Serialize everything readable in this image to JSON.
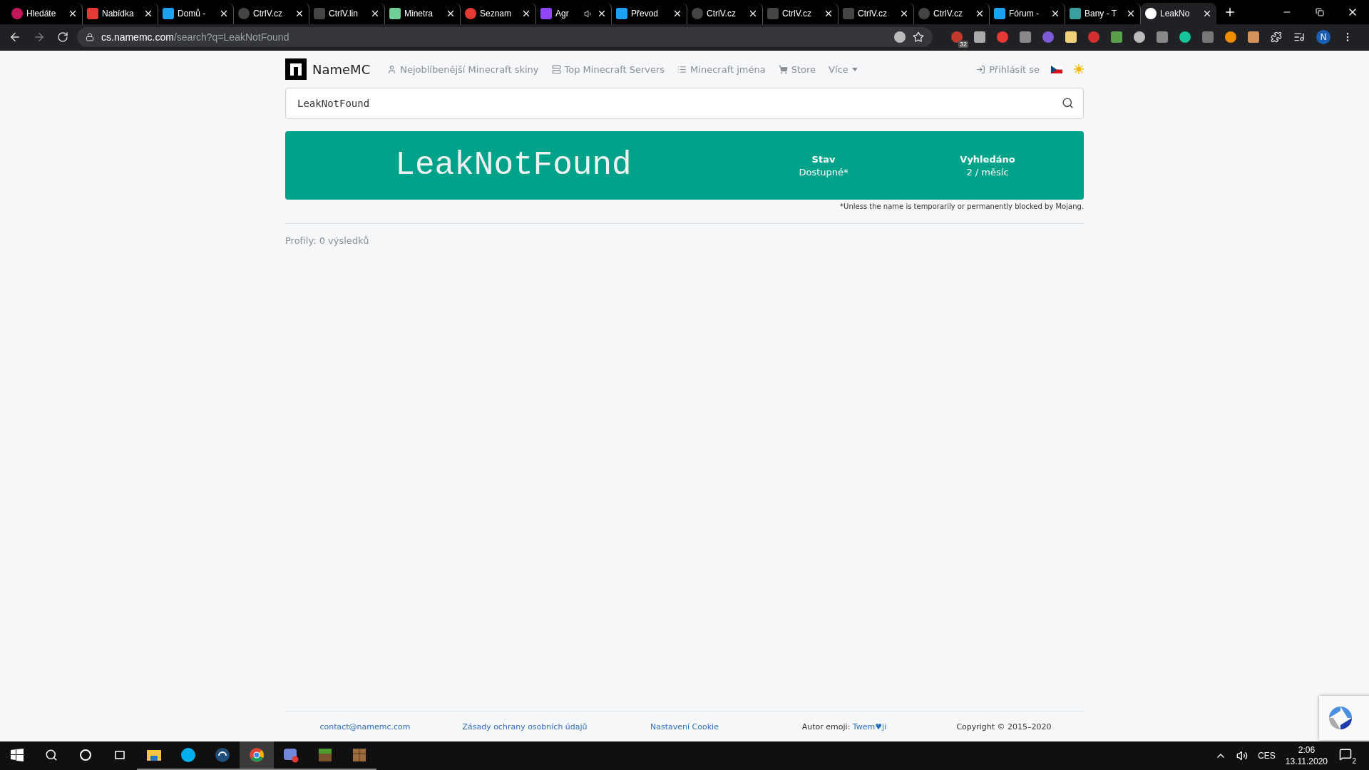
{
  "browser": {
    "tabs": [
      {
        "title": "Hledáte",
        "selected": false,
        "audio": false
      },
      {
        "title": "Nabídka",
        "selected": false,
        "audio": false
      },
      {
        "title": "Domů -",
        "selected": false,
        "audio": false
      },
      {
        "title": "CtrlV.cz",
        "selected": false,
        "audio": false
      },
      {
        "title": "CtrlV.lin",
        "selected": false,
        "audio": false
      },
      {
        "title": "Minetra",
        "selected": false,
        "audio": false
      },
      {
        "title": "Seznam",
        "selected": false,
        "audio": false
      },
      {
        "title": "Agr",
        "selected": false,
        "audio": true
      },
      {
        "title": "Převod",
        "selected": false,
        "audio": false
      },
      {
        "title": "CtrlV.cz",
        "selected": false,
        "audio": false
      },
      {
        "title": "CtrlV.cz",
        "selected": false,
        "audio": false
      },
      {
        "title": "CtrlV.cz",
        "selected": false,
        "audio": false
      },
      {
        "title": "CtrlV.cz",
        "selected": false,
        "audio": false
      },
      {
        "title": "Fórum -",
        "selected": false,
        "audio": false
      },
      {
        "title": "Bany - T",
        "selected": false,
        "audio": false
      },
      {
        "title": "LeakNo",
        "selected": true,
        "audio": false
      }
    ],
    "address": {
      "host": "cs.namemc.com",
      "path": "/search?q=LeakNotFound"
    },
    "extension_badge": "32",
    "profile_initial": "N"
  },
  "site": {
    "logo": "NameMC",
    "nav": [
      {
        "label": "Nejoblíbenější Minecraft skiny",
        "kind": "user"
      },
      {
        "label": "Top Minecraft Servers",
        "kind": "server"
      },
      {
        "label": "Minecraft jména",
        "kind": "list"
      },
      {
        "label": "Store",
        "kind": "cart"
      },
      {
        "label": "Více",
        "kind": "dropdown"
      }
    ],
    "login": "Přihlásit se",
    "search": {
      "value": "LeakNotFound"
    },
    "result": {
      "name": "LeakNotFound",
      "stats": [
        {
          "label": "Stav",
          "value": "Dostupné*"
        },
        {
          "label": "Vyhledáno",
          "value": "2 / měsíc"
        }
      ],
      "note": "*Unless the name is temporarily or permanently blocked by Mojang."
    },
    "profiles": "Profily: 0 výsledků",
    "footer": [
      {
        "text": "contact@namemc.com",
        "kind": "link"
      },
      {
        "text": "Zásady ochrany osobních údajů",
        "kind": "link"
      },
      {
        "text": "Nastavení Cookie",
        "kind": "link"
      },
      {
        "text": "Autor emoji: ",
        "link": "Twem♥ji",
        "kind": "credit"
      },
      {
        "text": "Copyright © 2015–2020",
        "kind": "plain"
      }
    ]
  },
  "taskbar": {
    "apps": [
      {
        "kind": "folder",
        "selected": false
      },
      {
        "kind": "skype",
        "selected": false
      },
      {
        "kind": "headset",
        "selected": false
      },
      {
        "kind": "chrome",
        "selected": true
      },
      {
        "kind": "discord",
        "selected": false
      },
      {
        "kind": "grass",
        "selected": false
      },
      {
        "kind": "chest",
        "selected": false
      }
    ],
    "language": "CES",
    "time": "2:06",
    "date": "13.11.2020",
    "notifications": "2"
  }
}
